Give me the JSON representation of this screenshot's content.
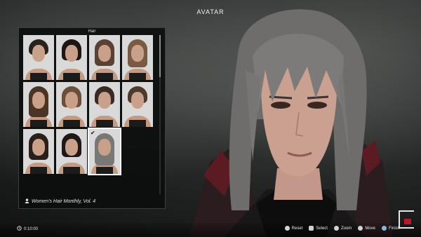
{
  "header": {
    "title": "AVATAR"
  },
  "panel": {
    "title": "Hair",
    "caption": "Women's Hair Monthly, Vol. 4",
    "selected_index": 10,
    "tile_count": 11
  },
  "footer": {
    "timer": "0:10:00",
    "prompts": [
      {
        "label": "Reset",
        "icon": "r3-button-icon"
      },
      {
        "label": "Select",
        "icon": "dpad-icon"
      },
      {
        "label": "Zoom",
        "icon": "r-stick-icon"
      },
      {
        "label": "Move",
        "icon": "l-stick-icon"
      },
      {
        "label": "Finish",
        "icon": "cross-button-icon"
      }
    ]
  },
  "colors": {
    "panel_bg": "#0c0d0d",
    "selection_outline": "#ffffff",
    "emblem_red": "#c0142a"
  }
}
